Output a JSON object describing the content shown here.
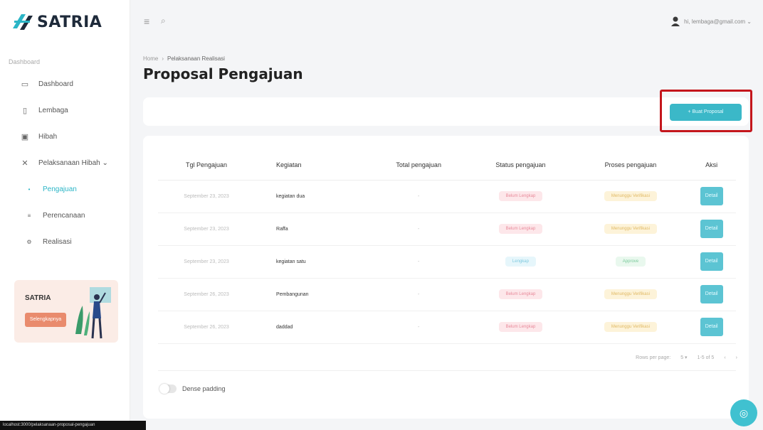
{
  "app": {
    "name": "SATRIA"
  },
  "sidebar": {
    "section_label": "Dashboard",
    "items": [
      {
        "label": "Dashboard",
        "icon": "monitor-icon",
        "glyph": "▭"
      },
      {
        "label": "Lembaga",
        "icon": "phone-icon",
        "glyph": "▯"
      },
      {
        "label": "Hibah",
        "icon": "gift-icon",
        "glyph": "▣"
      },
      {
        "label": "Pelaksanaan Hibah ⌄",
        "icon": "puzzle-icon",
        "glyph": "✕"
      },
      {
        "label": "Pengajuan",
        "icon": "dot-icon",
        "glyph": "•"
      },
      {
        "label": "Perencanaan",
        "icon": "list-icon",
        "glyph": "≡"
      },
      {
        "label": "Realisasi",
        "icon": "gear-icon",
        "glyph": "⚙"
      }
    ],
    "promo": {
      "title": "SATRIA",
      "button": "Selengkapnya"
    }
  },
  "topbar": {
    "menu_glyph": "≡",
    "search_glyph": "⌕",
    "user_email": "hi, lembaga@gmail.com ⌄"
  },
  "breadcrumb": {
    "home": "Home",
    "sep": "›",
    "current": "Pelaksanaan Realisasi"
  },
  "page_title": "Proposal Pengajuan",
  "create_button": "+ Buat Proposal",
  "table": {
    "headers": [
      "Tgl Pengajuan",
      "Kegiatan",
      "Total pengajuan",
      "Status pengajuan",
      "Proses pengajuan",
      "Aksi"
    ],
    "rows": [
      {
        "date": "September 23, 2023",
        "kegiatan": "kegiatan dua",
        "total": "-",
        "status": "Belum Lengkap",
        "status_color": "red",
        "proses": "Menunggu Verifikasi",
        "proses_color": "yellow",
        "aksi": "Detail"
      },
      {
        "date": "September 23, 2023",
        "kegiatan": "Raffa",
        "total": "-",
        "status": "Belum Lengkap",
        "status_color": "red",
        "proses": "Menunggu Verifikasi",
        "proses_color": "yellow",
        "aksi": "Detail"
      },
      {
        "date": "September 23, 2023",
        "kegiatan": "kegiatan satu",
        "total": "-",
        "status": "Lengkap",
        "status_color": "blue",
        "proses": "Approve",
        "proses_color": "green",
        "aksi": "Detail"
      },
      {
        "date": "September 26, 2023",
        "kegiatan": "Pembangunan",
        "total": "-",
        "status": "Belum Lengkap",
        "status_color": "red",
        "proses": "Menunggu Verifikasi",
        "proses_color": "yellow",
        "aksi": "Detail"
      },
      {
        "date": "September 26, 2023",
        "kegiatan": "daddad",
        "total": "-",
        "status": "Belum Lengkap",
        "status_color": "red",
        "proses": "Menunggu Verifikasi",
        "proses_color": "yellow",
        "aksi": "Detail"
      }
    ]
  },
  "pagination": {
    "rows_label": "Rows per page:",
    "rows_value": "5 ▾",
    "range": "1-5 of 5",
    "prev": "‹",
    "next": "›"
  },
  "dense_padding": "Dense padding",
  "tooltip": "localhost:3000/pelaksanaan-proposal-pengajuan",
  "fab_glyph": "◎",
  "colors": {
    "accent": "#3bb8c8",
    "highlight": "#c4161c",
    "promo_bg": "#fbece6",
    "promo_button": "#e98b6d"
  }
}
